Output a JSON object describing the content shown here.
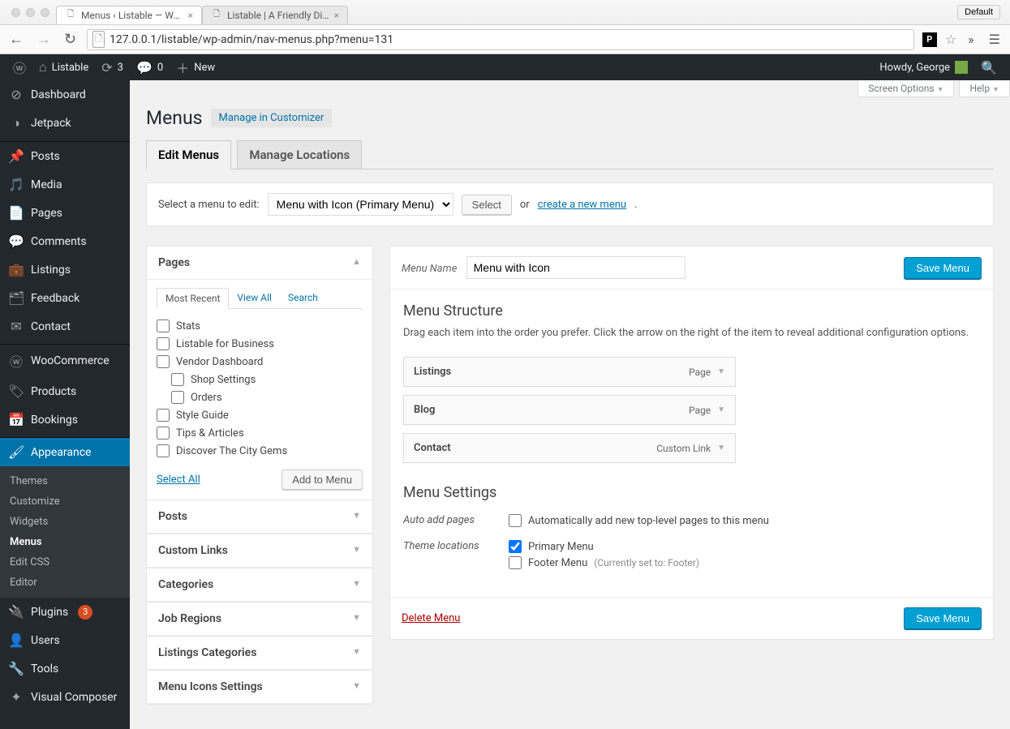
{
  "browser": {
    "tabs": [
      {
        "title": "Menus ‹ Listable — WordP"
      },
      {
        "title": "Listable | A Friendly Directo"
      }
    ],
    "default_label": "Default",
    "url": "127.0.0.1/listable/wp-admin/nav-menus.php?menu=131"
  },
  "adminbar": {
    "site_name": "Listable",
    "updates": "3",
    "comments": "0",
    "new_label": "New",
    "howdy": "Howdy, George"
  },
  "sidebar": {
    "items": [
      {
        "icon": "⊘",
        "label": "Dashboard"
      },
      {
        "icon": "◑",
        "label": "Jetpack"
      },
      {
        "sep": true
      },
      {
        "icon": "📌",
        "label": "Posts"
      },
      {
        "icon": "🎵",
        "label": "Media"
      },
      {
        "icon": "📄",
        "label": "Pages"
      },
      {
        "icon": "💬",
        "label": "Comments"
      },
      {
        "icon": "💼",
        "label": "Listings"
      },
      {
        "icon": "🗂",
        "label": "Feedback"
      },
      {
        "icon": "✉",
        "label": "Contact"
      },
      {
        "sep": true
      },
      {
        "icon": "ⓦ",
        "label": "WooCommerce"
      },
      {
        "icon": "🏷",
        "label": "Products"
      },
      {
        "icon": "📅",
        "label": "Bookings"
      },
      {
        "sep": true
      },
      {
        "icon": "🖌",
        "label": "Appearance",
        "current": true
      },
      {
        "icon": "🔌",
        "label": "Plugins",
        "badge": "3"
      },
      {
        "icon": "👤",
        "label": "Users"
      },
      {
        "icon": "🔧",
        "label": "Tools"
      },
      {
        "icon": "✦",
        "label": "Visual Composer"
      }
    ],
    "submenu": [
      {
        "label": "Themes"
      },
      {
        "label": "Customize"
      },
      {
        "label": "Widgets"
      },
      {
        "label": "Menus",
        "current": true
      },
      {
        "label": "Edit CSS"
      },
      {
        "label": "Editor"
      }
    ]
  },
  "screen_meta": {
    "screen_options": "Screen Options",
    "help": "Help"
  },
  "page": {
    "title": "Menus",
    "customizer": "Manage in Customizer",
    "tabs": {
      "edit": "Edit Menus",
      "locations": "Manage Locations"
    }
  },
  "select_row": {
    "label": "Select a menu to edit:",
    "selected": "Menu with Icon (Primary Menu)",
    "select_btn": "Select",
    "or": "or",
    "create_link": "create a new menu"
  },
  "pages_panel": {
    "title": "Pages",
    "tabs": {
      "recent": "Most Recent",
      "view_all": "View All",
      "search": "Search"
    },
    "items": [
      {
        "label": "Stats"
      },
      {
        "label": "Listable for Business"
      },
      {
        "label": "Vendor Dashboard"
      },
      {
        "label": "Shop Settings",
        "indent": true
      },
      {
        "label": "Orders",
        "indent": true
      },
      {
        "label": "Style Guide"
      },
      {
        "label": "Tips & Articles"
      },
      {
        "label": "Discover The City Gems"
      }
    ],
    "select_all": "Select All",
    "add_btn": "Add to Menu"
  },
  "accordions": [
    {
      "title": "Posts"
    },
    {
      "title": "Custom Links"
    },
    {
      "title": "Categories"
    },
    {
      "title": "Job Regions"
    },
    {
      "title": "Listings Categories"
    },
    {
      "title": "Menu Icons Settings"
    }
  ],
  "menu": {
    "name_label": "Menu Name",
    "name_value": "Menu with Icon",
    "save_btn": "Save Menu",
    "structure_title": "Menu Structure",
    "structure_desc": "Drag each item into the order you prefer. Click the arrow on the right of the item to reveal additional configuration options.",
    "items": [
      {
        "title": "Listings",
        "type": "Page"
      },
      {
        "title": "Blog",
        "type": "Page"
      },
      {
        "title": "Contact",
        "type": "Custom Link"
      }
    ],
    "settings_title": "Menu Settings",
    "auto_add_label": "Auto add pages",
    "auto_add_cb": "Automatically add new top-level pages to this menu",
    "locations_label": "Theme locations",
    "loc_primary": "Primary Menu",
    "loc_footer": "Footer Menu",
    "loc_footer_note": "(Currently set to: Footer)",
    "delete": "Delete Menu"
  }
}
